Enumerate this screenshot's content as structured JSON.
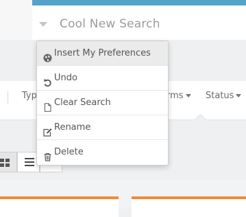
{
  "header": {
    "search_title": "Cool New Search"
  },
  "filters": {
    "type_label": "Typ",
    "terms_label": "rms",
    "status_label": "Status"
  },
  "menu": {
    "items": [
      {
        "label": "Insert My Preferences",
        "icon": "globe-icon"
      },
      {
        "label": "Undo",
        "icon": "undo-icon"
      },
      {
        "label": "Clear Search",
        "icon": "file-icon"
      },
      {
        "label": "Rename",
        "icon": "edit-icon"
      },
      {
        "label": "Delete",
        "icon": "trash-icon"
      }
    ]
  },
  "colors": {
    "accent_blue": "#56a3c9",
    "accent_orange": "#ef8a3c"
  }
}
